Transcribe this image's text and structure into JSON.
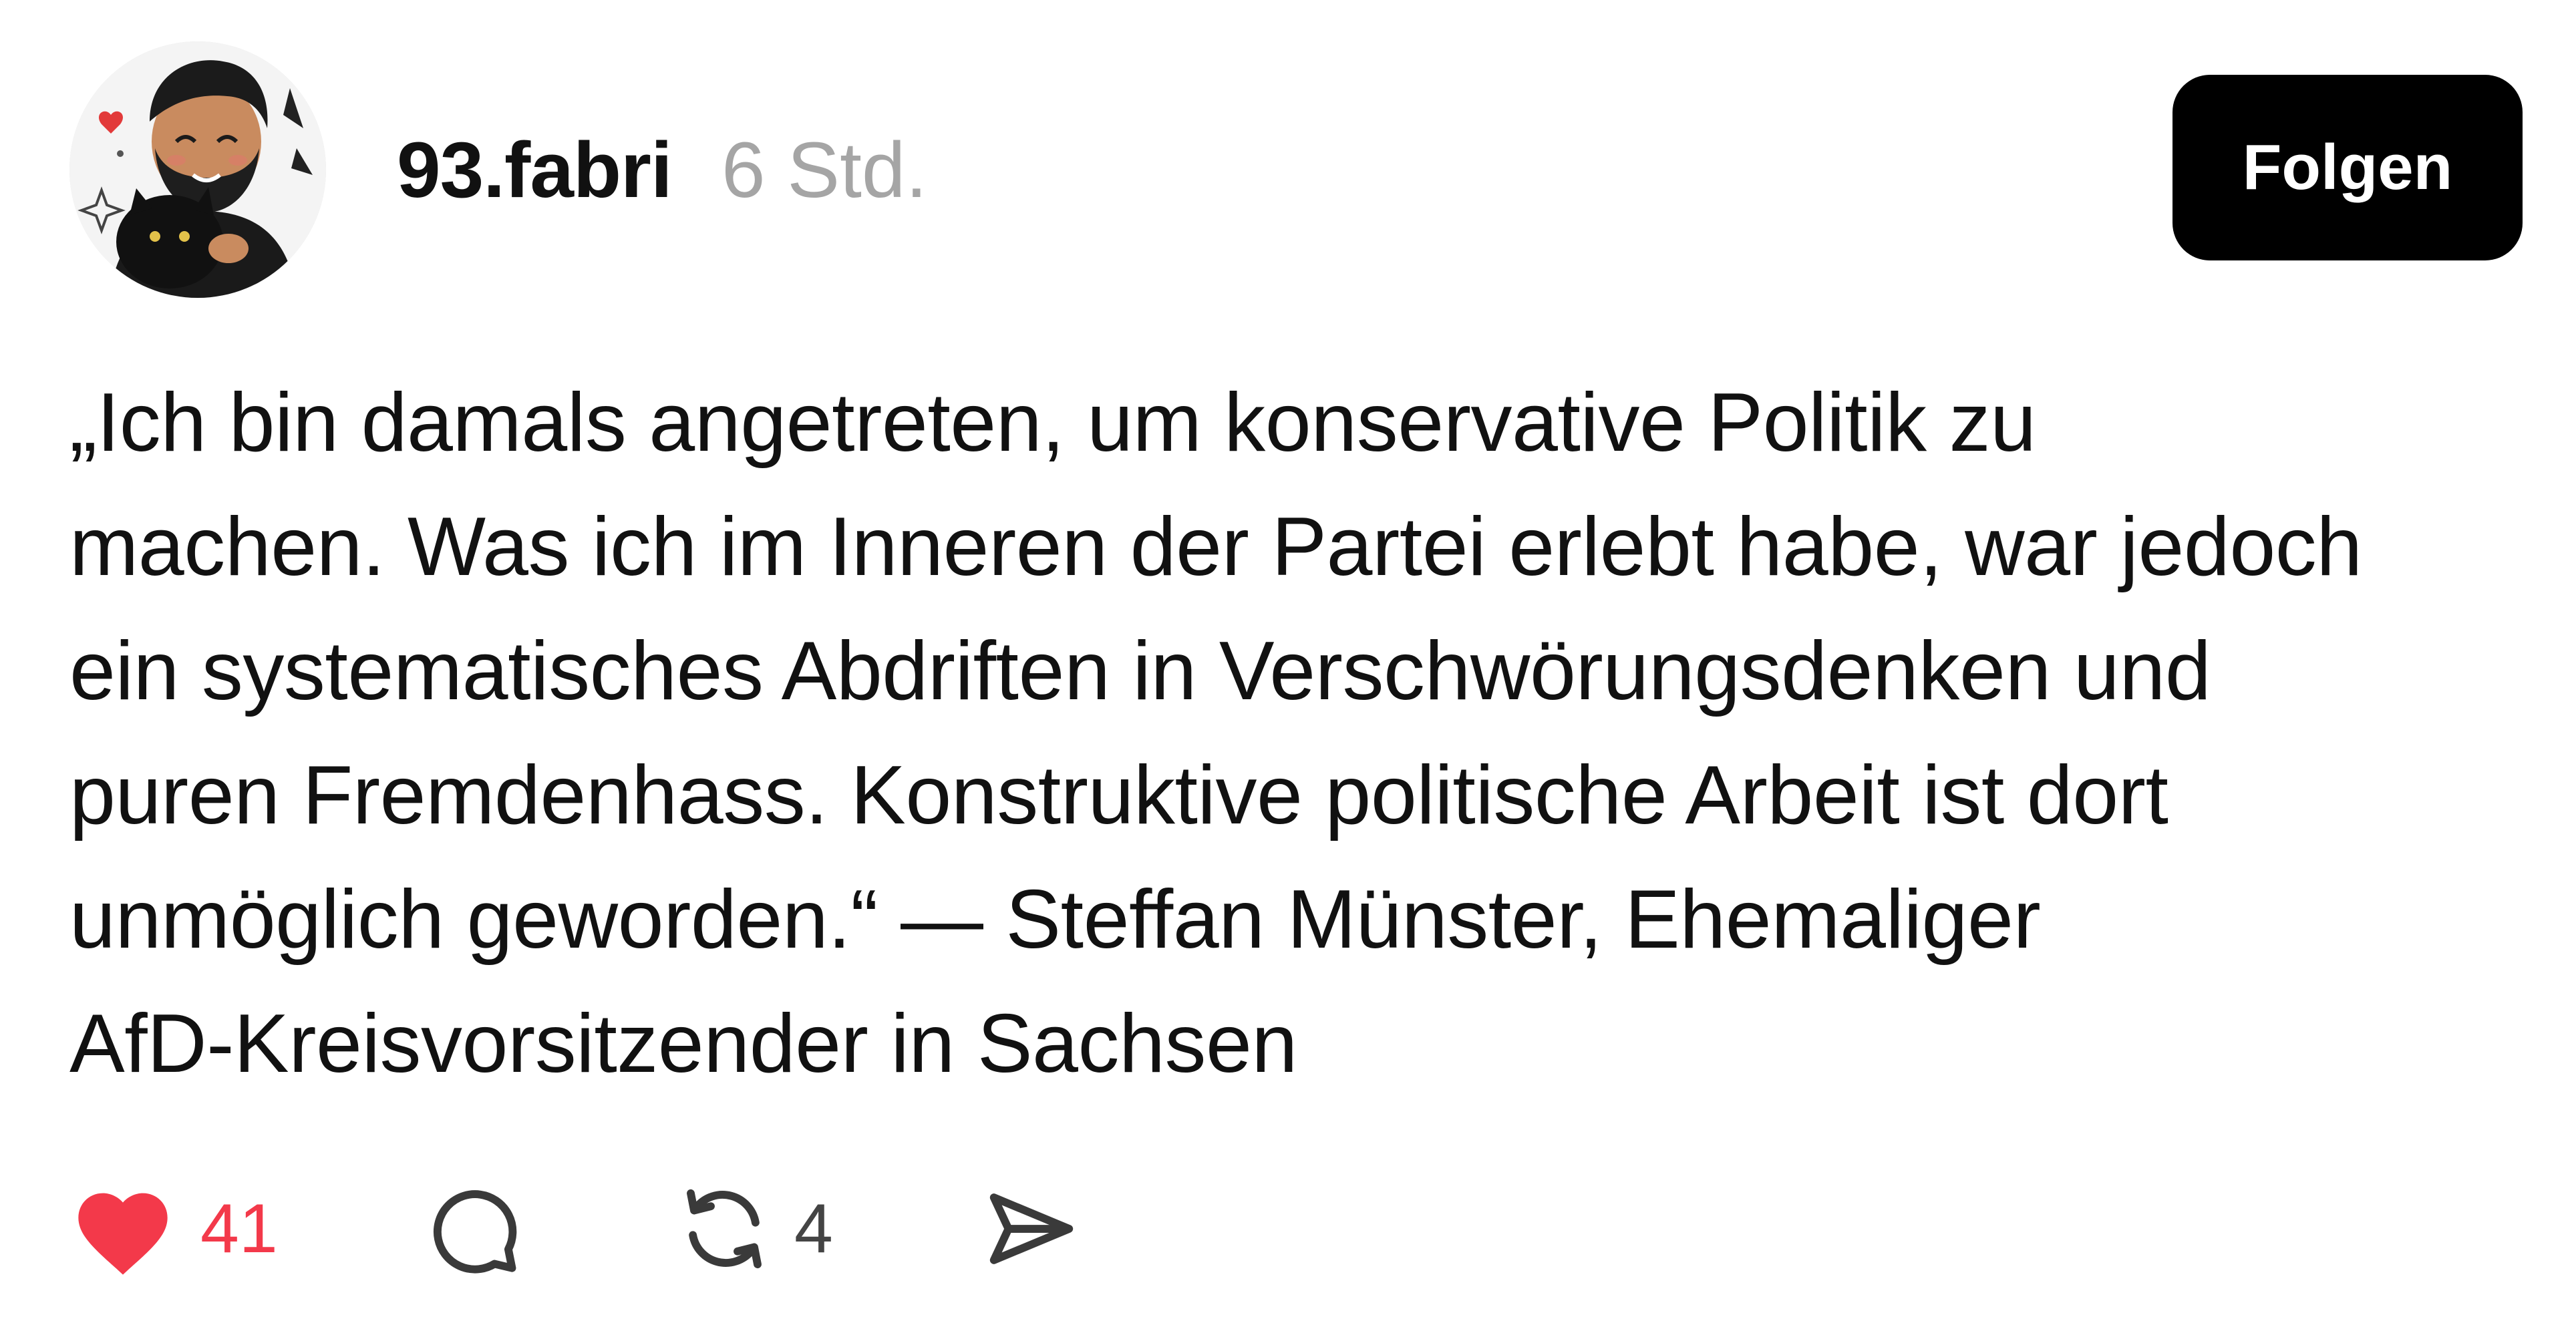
{
  "post": {
    "author": {
      "username": "93.fabri",
      "avatar": "avatar-illustration-man-with-black-cat"
    },
    "timestamp": "6 Std.",
    "follow_label": "Folgen",
    "text_lines": [
      "„Ich bin damals angetreten, um konservative Politik zu",
      "machen. Was ich im Inneren der Partei erlebt habe, war jedoch",
      "ein systematisches Abdriften in Verschwörungsdenken und",
      "puren Fremdenhass. Konstruktive politische Arbeit ist dort",
      "unmöglich geworden.“ — Steffan Münster, Ehemaliger",
      "AfD-Kreisvorsitzender in Sachsen"
    ],
    "actions": {
      "like": {
        "icon": "heart-filled-icon",
        "count": "41",
        "color": "#f3394a"
      },
      "comment": {
        "icon": "comment-bubble-icon"
      },
      "repost": {
        "icon": "repost-icon",
        "count": "4"
      },
      "share": {
        "icon": "send-icon"
      }
    }
  },
  "colors": {
    "text": "#111111",
    "muted": "#a5a5a5",
    "button_bg": "#000000",
    "button_text": "#ffffff",
    "like": "#f3394a",
    "icon": "#3a3a3a"
  }
}
